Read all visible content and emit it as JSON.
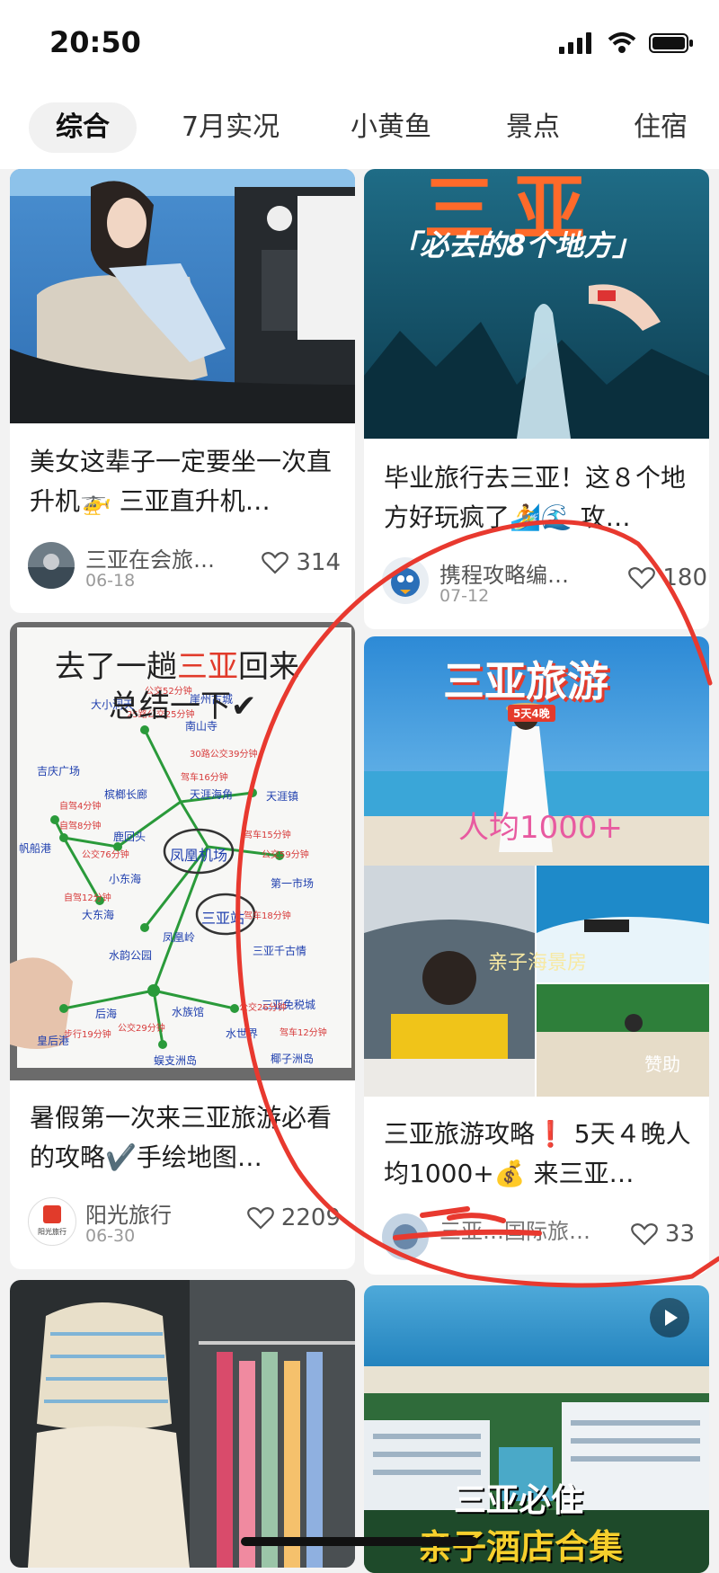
{
  "status_bar": {
    "time": "20:50"
  },
  "tabs": [
    {
      "label": "综合",
      "active": true
    },
    {
      "label": "7月实况"
    },
    {
      "label": "小黄鱼"
    },
    {
      "label": "景点"
    },
    {
      "label": "住宿"
    }
  ],
  "cards": {
    "c1": {
      "title": "美女这辈子一定要坐一次直升机🚁 三亚直升机…",
      "author": "三亚在会旅…",
      "date": "06-18",
      "likes": "314"
    },
    "c2": {
      "image_text_top": "三亚",
      "image_text_sub": "「必去的8个地方」",
      "title": "毕业旅行去三亚！这８个地方好玩疯了🏄🌊 攻…",
      "author": "携程攻略编…",
      "date": "07-12",
      "likes": "180"
    },
    "c3": {
      "map_title_a": "去了一趟",
      "map_title_b": "三亚",
      "map_title_c": "回来",
      "map_title_d": "总结一下✔",
      "center_a": "凤凰机场",
      "center_b": "三亚站",
      "title": "暑假第一次来三亚旅游必看的攻略✔️手绘地图…",
      "author": "阳光旅行",
      "avatar_text": "阳光旅行",
      "date": "06-30",
      "likes": "2209"
    },
    "c4": {
      "image_text_top": "三亚旅游",
      "image_badge": "5天4晚",
      "image_price": "人均1000+",
      "image_hotel": "亲子海景房",
      "image_sponsor": "赞助",
      "title": "三亚旅游攻略❗ 5天４晚人均1000+💰 来三亚…",
      "author": "三亚…国际旅…",
      "likes": "33"
    },
    "c6": {
      "image_text_a": "三亚必住",
      "image_text_b": "亲子酒店合集"
    }
  },
  "colors": {
    "accent_red": "#e53b2c",
    "annotation_red": "#e8392f"
  }
}
